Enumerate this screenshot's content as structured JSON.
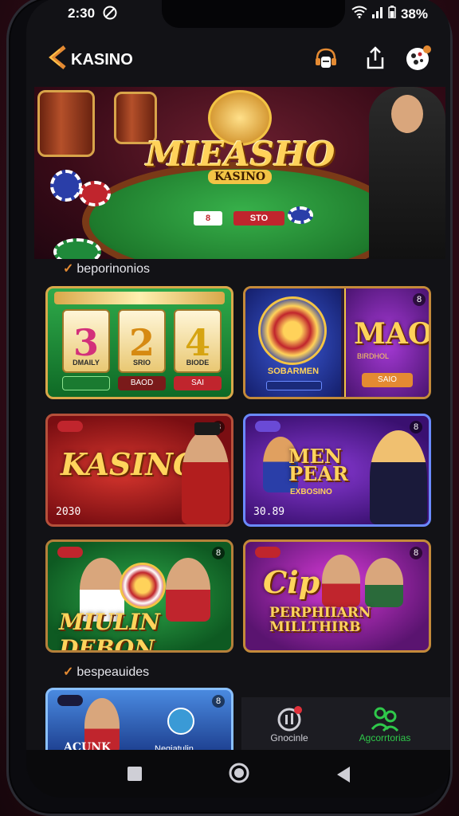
{
  "status": {
    "time": "2:30",
    "battery": "38%"
  },
  "app": {
    "name": "KASINO"
  },
  "hero": {
    "title": "MIEASHO",
    "subtitle": "KASINO",
    "card_left": "8",
    "card_right": "STO"
  },
  "sections": [
    {
      "title": "beporinonios"
    },
    {
      "title": "bespeauides"
    }
  ],
  "tiles": [
    {
      "type": "slot",
      "reels": [
        {
          "digit": "3",
          "label": "DMAILY"
        },
        {
          "digit": "2",
          "label": "SRIO"
        },
        {
          "digit": "4",
          "label": "BIODE"
        }
      ],
      "buttons": [
        "",
        "BAOD",
        "SAI"
      ]
    },
    {
      "type": "split",
      "left_label": "SOBARMEN",
      "right_title": "MAO",
      "right_sub": "BIRDHOL",
      "right_btn": "SAIO",
      "right_close": "8"
    },
    {
      "title": "KASINO",
      "value": "2030",
      "badge": "",
      "close": "8"
    },
    {
      "title": "MEN PEAR",
      "sub": "EXBOSINO",
      "value": "30.89",
      "badge": "",
      "close": "8"
    },
    {
      "title": "MIULIN DEBON",
      "badge": "",
      "close": "8"
    },
    {
      "title": "Cip",
      "sub": "PERPHIIARN MILLTHIRB",
      "badge": "",
      "close": "8"
    }
  ],
  "peek_tile": {
    "title": "ACUNK",
    "sub": "Neqjatulin"
  },
  "bottom_nav": [
    {
      "label": "Gnocinle",
      "icon": "chip-icon",
      "active": false
    },
    {
      "label": "Agcorrtorias",
      "icon": "people-icon",
      "active": true
    }
  ],
  "colors": {
    "accent": "#e48a32",
    "active": "#2fc84a",
    "gold": "#ffd45c"
  }
}
